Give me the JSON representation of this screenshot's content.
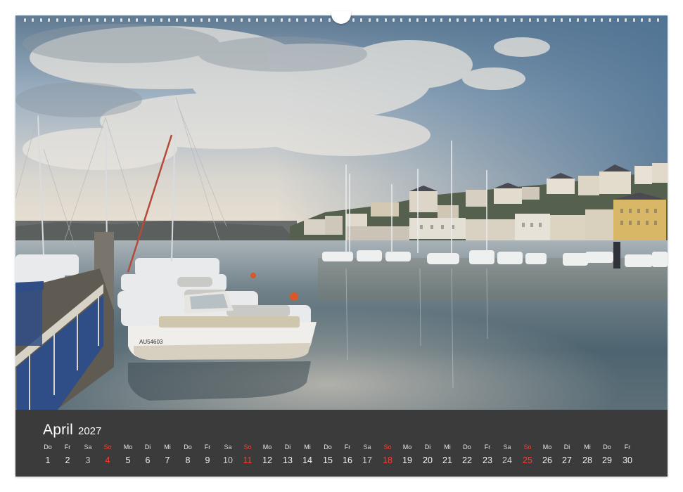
{
  "calendar": {
    "month": "April",
    "year": "2027",
    "sunday_color": "#ff3b30",
    "days": [
      {
        "dow": "Do",
        "num": "1"
      },
      {
        "dow": "Fr",
        "num": "2"
      },
      {
        "dow": "Sa",
        "num": "3"
      },
      {
        "dow": "So",
        "num": "4"
      },
      {
        "dow": "Mo",
        "num": "5"
      },
      {
        "dow": "Di",
        "num": "6"
      },
      {
        "dow": "Mi",
        "num": "7"
      },
      {
        "dow": "Do",
        "num": "8"
      },
      {
        "dow": "Fr",
        "num": "9"
      },
      {
        "dow": "Sa",
        "num": "10"
      },
      {
        "dow": "So",
        "num": "11"
      },
      {
        "dow": "Mo",
        "num": "12"
      },
      {
        "dow": "Di",
        "num": "13"
      },
      {
        "dow": "Mi",
        "num": "14"
      },
      {
        "dow": "Do",
        "num": "15"
      },
      {
        "dow": "Fr",
        "num": "16"
      },
      {
        "dow": "Sa",
        "num": "17"
      },
      {
        "dow": "So",
        "num": "18"
      },
      {
        "dow": "Mo",
        "num": "19"
      },
      {
        "dow": "Di",
        "num": "20"
      },
      {
        "dow": "Mi",
        "num": "21"
      },
      {
        "dow": "Do",
        "num": "22"
      },
      {
        "dow": "Fr",
        "num": "23"
      },
      {
        "dow": "Sa",
        "num": "24"
      },
      {
        "dow": "So",
        "num": "25"
      },
      {
        "dow": "Mo",
        "num": "26"
      },
      {
        "dow": "Di",
        "num": "27"
      },
      {
        "dow": "Mi",
        "num": "28"
      },
      {
        "dow": "Do",
        "num": "29"
      },
      {
        "dow": "Fr",
        "num": "30"
      }
    ]
  },
  "photo": {
    "boat_registration": "AU54603"
  }
}
